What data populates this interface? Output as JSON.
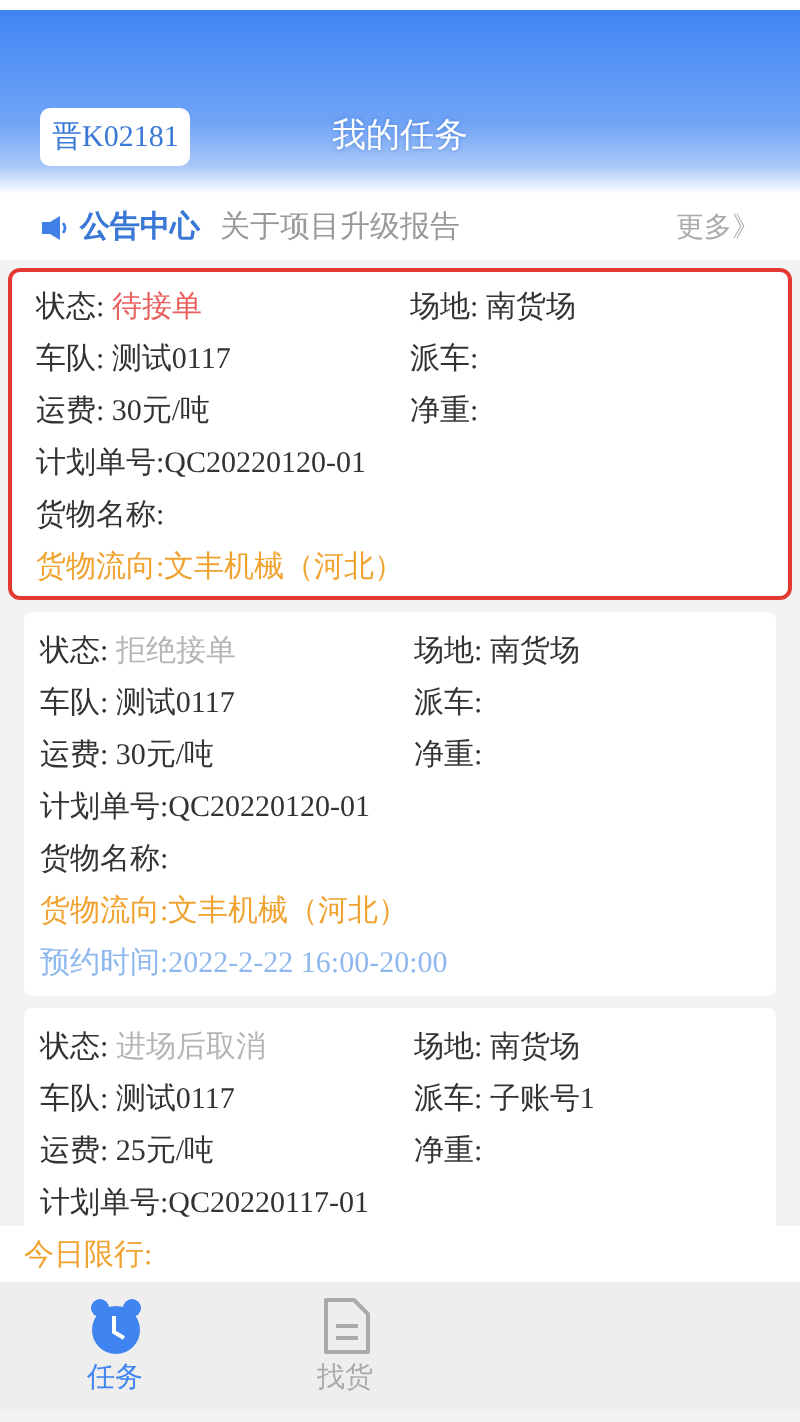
{
  "header": {
    "plate": "晋K02181",
    "title": "我的任务"
  },
  "notice": {
    "label": "公告中心",
    "text": "关于项目升级报告",
    "more": "更多》"
  },
  "tasks": [
    {
      "selected": true,
      "status_label": "状态:",
      "status": "待接单",
      "color": "#e8615f",
      "site": "场地: 南货场",
      "team": "车队: 测试0117",
      "dispatch": "派车:",
      "fee": "运费: 30元/吨",
      "net": "净重:",
      "plan": "计划单号:QC20220120-01",
      "goods": "货物名称:",
      "flow": "货物流向:文丰机械（河北）"
    },
    {
      "selected": false,
      "status_label": "状态:",
      "status": "拒绝接单",
      "color": "#b5b5b5",
      "site": "场地: 南货场",
      "team": "车队: 测试0117",
      "dispatch": "派车:",
      "fee": "运费: 30元/吨",
      "net": "净重:",
      "plan": "计划单号:QC20220120-01",
      "goods": "货物名称:",
      "flow": "货物流向:文丰机械（河北）",
      "appointment": "预约时间:2022-2-22 16:00-20:00"
    },
    {
      "selected": false,
      "status_label": "状态:",
      "status": "进场后取消",
      "color": "#b5b5b5",
      "site": "场地: 南货场",
      "team": "车队: 测试0117",
      "dispatch": "派车: 子账号1",
      "fee": "运费: 25元/吨",
      "net": "净重:",
      "plan": "计划单号:QC20220117-01"
    }
  ],
  "limit": "今日限行:",
  "tabs": [
    {
      "label": "任务",
      "selected": true
    },
    {
      "label": "找货",
      "selected": false
    }
  ]
}
